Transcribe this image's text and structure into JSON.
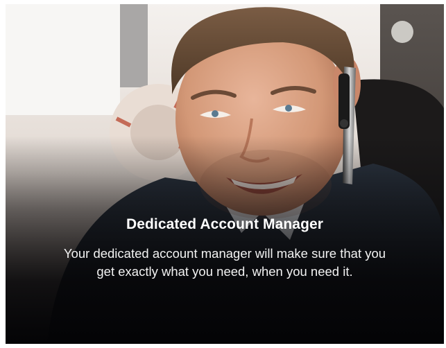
{
  "card": {
    "title": "Dedicated Account Manager",
    "description": "Your dedicated account manager will make sure that you get exactly what you need, when you need it."
  },
  "photo": {
    "subject": "smiling-man-with-headset-photo"
  }
}
